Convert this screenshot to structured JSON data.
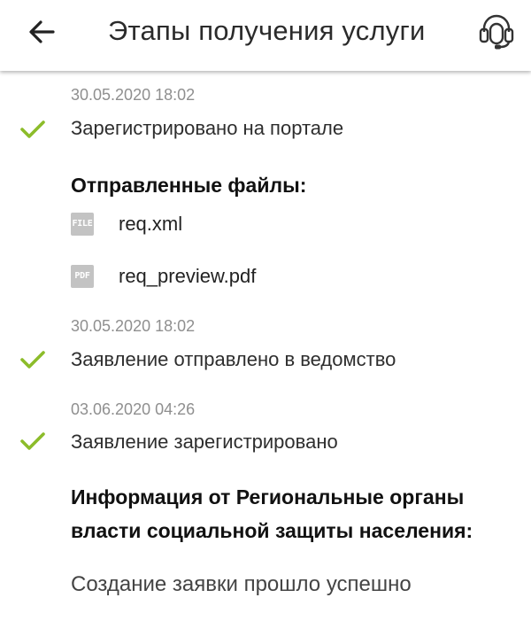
{
  "header": {
    "title": "Этапы получения услуги",
    "back_icon": "arrow-left-icon",
    "support_icon": "headset-icon"
  },
  "colors": {
    "check": "#8cbc2a",
    "timestamp": "#8f8f8f",
    "file_icon_bg": "#c3c3c3"
  },
  "steps": [
    {
      "timestamp": "30.05.2020 18:02",
      "text": "Зарегистрировано на портале"
    },
    {
      "timestamp": "30.05.2020 18:02",
      "text": "Заявление отправлено в ведомство"
    },
    {
      "timestamp": "03.06.2020 04:26",
      "text": "Заявление зарегистрировано"
    }
  ],
  "files_section": {
    "title": "Отправленные файлы:",
    "files": [
      {
        "type_label": "FILE",
        "name": "req.xml"
      },
      {
        "type_label": "PDF",
        "name": "req_preview.pdf"
      }
    ]
  },
  "info_section": {
    "title_line1": "Информация от Региональные органы",
    "title_line2": "власти социальной защиты населения:",
    "message": "Создание заявки прошло успешно"
  }
}
